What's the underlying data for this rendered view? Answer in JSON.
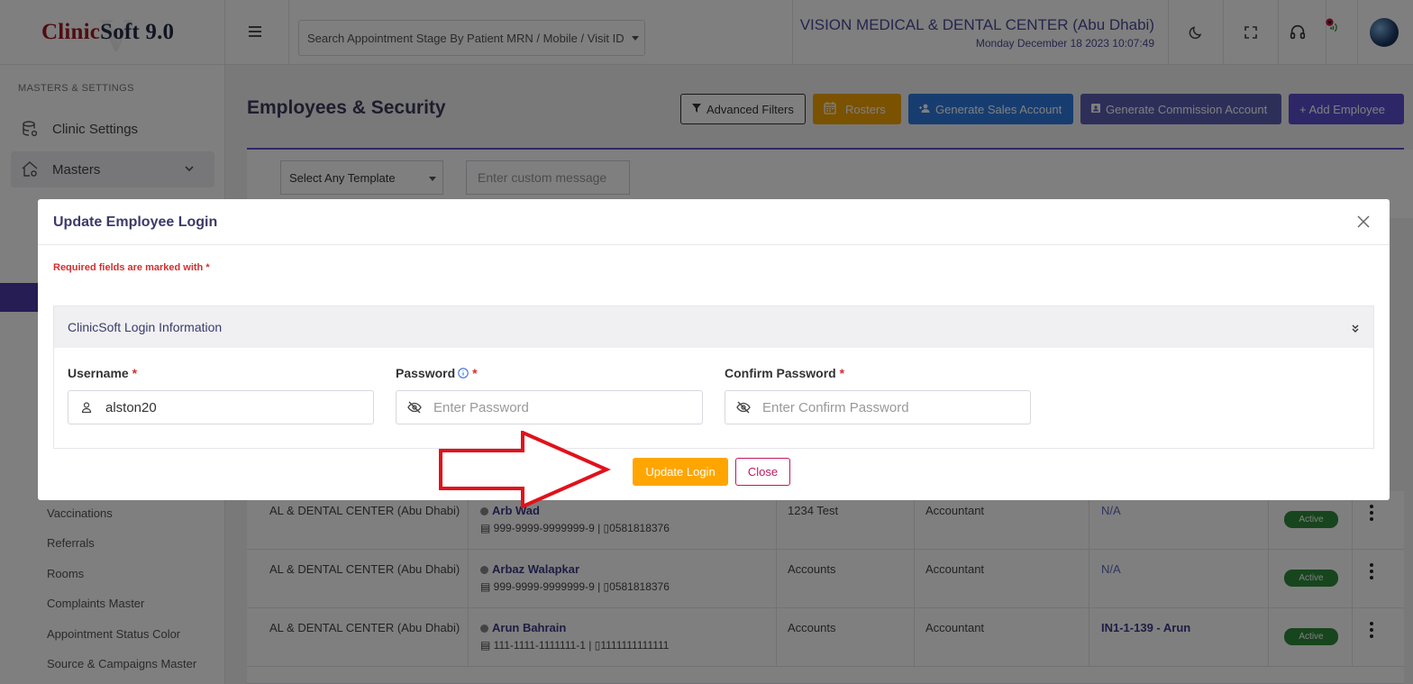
{
  "app": {
    "logo_part1": "Clinic",
    "logo_part2": "Soft 9.0",
    "logo_watermark": "V"
  },
  "sidebar": {
    "section_label": "MASTERS & SETTINGS",
    "items": [
      {
        "label": "Clinic Settings",
        "icon": "database-gear-icon"
      },
      {
        "label": "Masters",
        "icon": "home-gear-icon"
      }
    ],
    "sub_items": [
      "Vaccinations",
      "Referrals",
      "Rooms",
      "Complaints Master",
      "Appointment Status Color",
      "Source & Campaigns Master"
    ]
  },
  "topbar": {
    "search_placeholder": "Search Appointment Stage By Patient MRN / Mobile / Visit ID",
    "clinic_name": "VISION MEDICAL & DENTAL CENTER (Abu Dhabi)",
    "datetime": "Monday December 18 2023 10:07:49",
    "icons": [
      "menu-icon",
      "moon-icon",
      "fullscreen-icon",
      "headset-icon",
      "notification-icon",
      "avatar"
    ]
  },
  "page": {
    "title": "Employees & Security",
    "buttons": {
      "advanced_filters": "Advanced Filters",
      "rosters": "Rosters",
      "generate_sales": "Generate Sales Account",
      "generate_commission": "Generate Commission Account",
      "add_employee": "+ Add Employee"
    },
    "template_select": "Select Any Template",
    "custom_message_placeholder": "Enter custom message"
  },
  "table": {
    "rows": [
      {
        "clinic": "AL & DENTAL CENTER (Abu Dhabi)",
        "name": "Arb Wad",
        "ids": "999-9999-9999999-9 | ▯0581818376",
        "department": "1234 Test",
        "role": "Accountant",
        "account": "N/A",
        "status": "Active"
      },
      {
        "clinic": "AL & DENTAL CENTER (Abu Dhabi)",
        "name": "Arbaz Walapkar",
        "ids": "999-9999-9999999-9 | ▯0581818376",
        "department": "Accounts",
        "role": "Accountant",
        "account": "N/A",
        "status": "Active"
      },
      {
        "clinic": "AL & DENTAL CENTER (Abu Dhabi)",
        "name": "Arun Bahrain",
        "ids": "111-1111-1111111-1 | ▯1111111111111",
        "department": "Accounts",
        "role": "Accountant",
        "account": "IN1-1-139 - Arun",
        "status": "Active"
      }
    ]
  },
  "modal": {
    "title": "Update Employee Login",
    "required_note": "Required fields are marked with",
    "required_mark": "*",
    "panel_title": "ClinicSoft Login Information",
    "username_label": "Username",
    "username_value": "alston20",
    "password_label": "Password",
    "password_placeholder": "Enter Password",
    "confirm_label": "Confirm Password",
    "confirm_placeholder": "Enter Confirm Password",
    "update_button": "Update Login",
    "close_button": "Close"
  },
  "colors": {
    "accent": "#5a4fd0",
    "warning": "#ffa500",
    "danger": "#c2185b",
    "annotation_arrow": "#e0121b"
  }
}
